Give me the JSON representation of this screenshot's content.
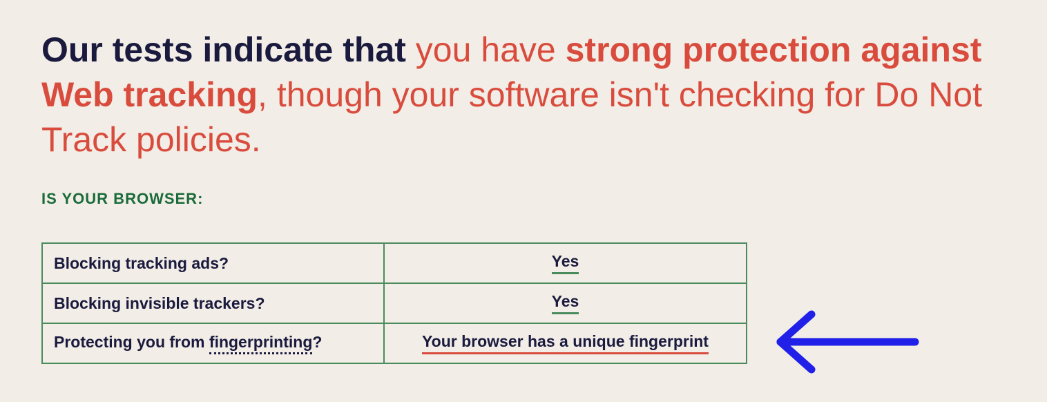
{
  "headline": {
    "part1": "Our tests indicate that ",
    "part2": "you have ",
    "part3": "strong protection against Web tracking",
    "part4": ", though your software isn't checking for Do Not Track policies."
  },
  "subheading": "IS YOUR BROWSER:",
  "table": {
    "rows": [
      {
        "label_prefix": "Blocking tracking ads?",
        "label_link": "",
        "label_suffix": "",
        "value": "Yes",
        "value_style": "green"
      },
      {
        "label_prefix": "Blocking invisible trackers?",
        "label_link": "",
        "label_suffix": "",
        "value": "Yes",
        "value_style": "green"
      },
      {
        "label_prefix": "Protecting you from ",
        "label_link": "fingerprinting",
        "label_suffix": "?",
        "value": "Your browser has a unique fingerprint",
        "value_style": "red"
      }
    ]
  }
}
